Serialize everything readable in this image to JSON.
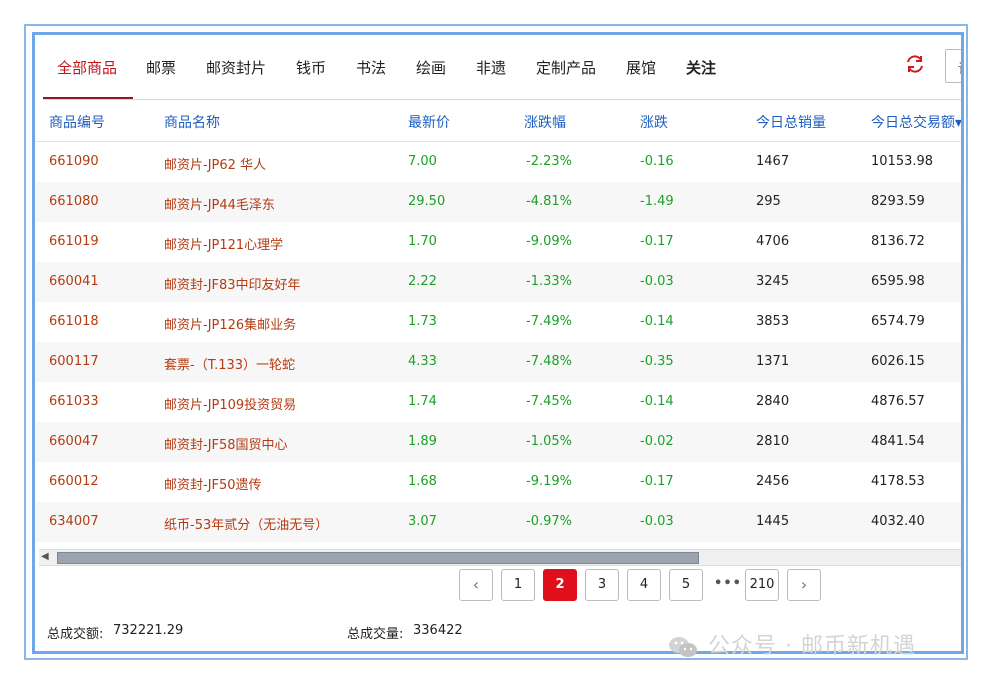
{
  "tabs": [
    {
      "label": "全部商品",
      "active": true
    },
    {
      "label": "邮票"
    },
    {
      "label": "邮资封片"
    },
    {
      "label": "钱币"
    },
    {
      "label": "书法"
    },
    {
      "label": "绘画"
    },
    {
      "label": "非遗"
    },
    {
      "label": "定制产品"
    },
    {
      "label": "展馆"
    },
    {
      "label": "关注",
      "bold": true
    }
  ],
  "header_icons": {
    "refresh": "refresh-icon"
  },
  "search": {
    "placeholder": "请"
  },
  "table": {
    "headers": [
      "商品编号",
      "商品名称",
      "最新价",
      "涨跌幅",
      "涨跌",
      "今日总销量",
      "今日总交易额▾"
    ],
    "rows": [
      {
        "code": "661090",
        "name": "邮资片-JP62 华人",
        "price": "7.00",
        "pct": "-2.23%",
        "chg": "-0.16",
        "vol": "1467",
        "amt": "10153.98"
      },
      {
        "code": "661080",
        "name": "邮资片-JP44毛泽东",
        "price": "29.50",
        "pct": "-4.81%",
        "chg": "-1.49",
        "vol": "295",
        "amt": "8293.59"
      },
      {
        "code": "661019",
        "name": "邮资片-JP121心理学",
        "price": "1.70",
        "pct": "-9.09%",
        "chg": "-0.17",
        "vol": "4706",
        "amt": "8136.72"
      },
      {
        "code": "660041",
        "name": "邮资封-JF83中印友好年",
        "price": "2.22",
        "pct": "-1.33%",
        "chg": "-0.03",
        "vol": "3245",
        "amt": "6595.98"
      },
      {
        "code": "661018",
        "name": "邮资片-JP126集邮业务",
        "price": "1.73",
        "pct": "-7.49%",
        "chg": "-0.14",
        "vol": "3853",
        "amt": "6574.79"
      },
      {
        "code": "600117",
        "name": "套票-（T.133）一轮蛇",
        "price": "4.33",
        "pct": "-7.48%",
        "chg": "-0.35",
        "vol": "1371",
        "amt": "6026.15"
      },
      {
        "code": "661033",
        "name": "邮资片-JP109投资贸易",
        "price": "1.74",
        "pct": "-7.45%",
        "chg": "-0.14",
        "vol": "2840",
        "amt": "4876.57"
      },
      {
        "code": "660047",
        "name": "邮资封-JF58国贸中心",
        "price": "1.89",
        "pct": "-1.05%",
        "chg": "-0.02",
        "vol": "2810",
        "amt": "4841.54"
      },
      {
        "code": "660012",
        "name": "邮资封-JF50遗传",
        "price": "1.68",
        "pct": "-9.19%",
        "chg": "-0.17",
        "vol": "2456",
        "amt": "4178.53"
      },
      {
        "code": "634007",
        "name": "纸币-53年贰分（无油无号）",
        "price": "3.07",
        "pct": "-0.97%",
        "chg": "-0.03",
        "vol": "1445",
        "amt": "4032.40"
      }
    ]
  },
  "pagination": {
    "prev": "‹",
    "pages": [
      "1",
      "2",
      "3",
      "4",
      "5"
    ],
    "current": "2",
    "ellipsis": "•••",
    "last": "210",
    "next": "›"
  },
  "footer": {
    "total_amount_label": "总成交额:",
    "total_amount": "732221.29",
    "total_volume_label": "总成交量:",
    "total_volume": "336422"
  },
  "watermark": {
    "text": "公众号 · 邮币新机遇"
  },
  "colors": {
    "accent": "#c0171b",
    "header_blue": "#1e5fc0",
    "down_green": "#1ca129",
    "code_red": "#b33b12",
    "frame_blue": "#6fa8e8"
  }
}
